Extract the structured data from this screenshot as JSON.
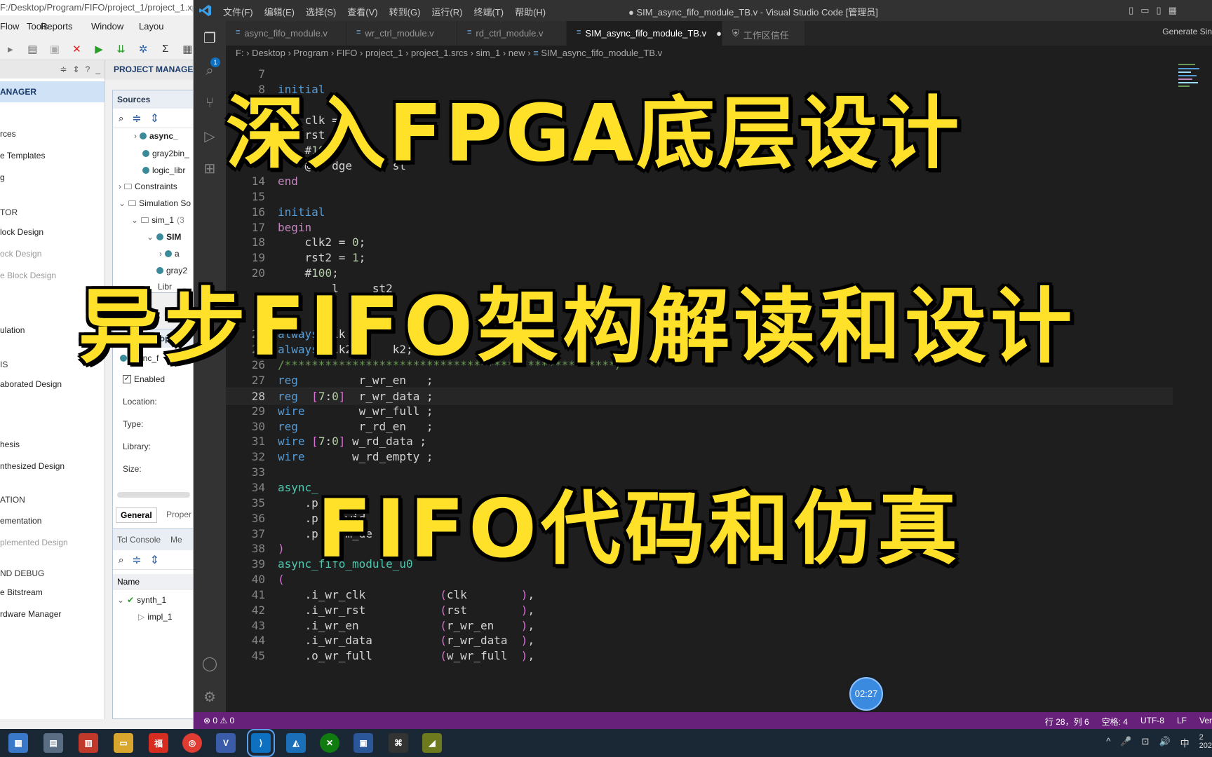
{
  "colors": {
    "accent": "#007acc",
    "status_bar": "#68217a",
    "overlay_text": "#ffe12a",
    "vivado_selection": "#cfe2f6"
  },
  "vivado": {
    "title_path": "F:/Desktop/Program/FIFO/project_1/project_1.xpr",
    "menu": [
      "Flow",
      "Tools",
      "Reports",
      "Window",
      "Layou"
    ],
    "flow_nav": {
      "section": "ANAGER",
      "items": [
        "rces",
        "e Templates",
        "g",
        "TOR",
        "lock Design",
        "ock Design",
        "e Block Design",
        "ulation",
        "IS",
        "aborated Design",
        "hesis",
        "nthesized Design",
        "ATION",
        "ementation",
        "plemented Design",
        "ND DEBUG",
        "e Bitstream",
        "rdware Manager"
      ]
    },
    "project_manager_title": "PROJECT MANAGER",
    "sources": {
      "title": "Sources",
      "rows": [
        "async_",
        "gray2bin_",
        "logic_libr",
        "Constraints",
        "Simulation So",
        "sim_1",
        "(3",
        "SIM",
        "a",
        "gray2"
      ],
      "tabs": [
        "Hi",
        "Libr"
      ]
    },
    "properties": {
      "title": "Prope",
      "file": "async_f",
      "enabled_label": "Enabled",
      "fields": [
        "Location:",
        "Type:",
        "Library:",
        "Size:"
      ],
      "tabs": [
        "General",
        "Proper"
      ]
    },
    "tcl": {
      "tabs": [
        "Tcl Console",
        "Me"
      ],
      "column": "Name",
      "rows": [
        "synth_1",
        "impl_1"
      ]
    }
  },
  "vscode": {
    "window_title": "● SIM_async_fifo_module_TB.v - Visual Studio Code [管理员]",
    "menu": [
      "文件(F)",
      "编辑(E)",
      "选择(S)",
      "查看(V)",
      "转到(G)",
      "运行(R)",
      "终端(T)",
      "帮助(H)"
    ],
    "explorer_badge": "1",
    "tabs": [
      {
        "label": "async_fifo_module.v"
      },
      {
        "label": "wr_ctrl_module.v"
      },
      {
        "label": "rd_ctrl_module.v"
      },
      {
        "label": "SIM_async_fifo_module_TB.v"
      },
      {
        "label": "工作区信任"
      }
    ],
    "tab_right": "Generate   Sin",
    "breadcrumb": [
      "F:",
      "Desktop",
      "Program",
      "FIFO",
      "project_1",
      "project_1.srcs",
      "sim_1",
      "new",
      "SIM_async_fifo_module_TB.v"
    ],
    "code": [
      {
        "n": "7",
        "t": ""
      },
      {
        "n": "8",
        "t": "initial"
      },
      {
        "n": "",
        "t": " in"
      },
      {
        "n": "",
        "t": "    clk ="
      },
      {
        "n": "",
        "t": "    rst ="
      },
      {
        "n": "",
        "t": "    #100"
      },
      {
        "n": "",
        "t": "    @(r dge      st"
      },
      {
        "n": "14",
        "t": "end"
      },
      {
        "n": "15",
        "t": ""
      },
      {
        "n": "16",
        "t": "initial"
      },
      {
        "n": "17",
        "t": "begin"
      },
      {
        "n": "18",
        "t": "    clk2 = 0;"
      },
      {
        "n": "19",
        "t": "    rst2 = 1;"
      },
      {
        "n": "20",
        "t": "    #100;"
      },
      {
        "n": "",
        "t": "        l     st2"
      },
      {
        "n": "",
        "t": ""
      },
      {
        "n": "",
        "t": ""
      },
      {
        "n": "24",
        "t": "always  lk =  "
      },
      {
        "n": "25",
        "t": "always  lk2 =    k2;"
      },
      {
        "n": "26",
        "t": "/*************************************************/"
      },
      {
        "n": "27",
        "t": "reg         r_wr_en   ;"
      },
      {
        "n": "28",
        "t": "reg  [7:0]  r_wr_data ;"
      },
      {
        "n": "29",
        "t": "wire        w_wr_full ;"
      },
      {
        "n": "30",
        "t": "reg         r_rd_en   ;"
      },
      {
        "n": "31",
        "t": "wire [7:0] w_rd_data ;"
      },
      {
        "n": "32",
        "t": "wire       w_rd_empty ;"
      },
      {
        "n": "33",
        "t": ""
      },
      {
        "n": "34",
        "t": "async_"
      },
      {
        "n": "35",
        "t": "    .p"
      },
      {
        "n": "36",
        "t": "    .p    wid"
      },
      {
        "n": "37",
        "t": "    .p    m_de"
      },
      {
        "n": "38",
        "t": ")"
      },
      {
        "n": "39",
        "t": "async_fifo_module_u0"
      },
      {
        "n": "40",
        "t": "("
      },
      {
        "n": "41",
        "t": "    .i_wr_clk           (clk        ),"
      },
      {
        "n": "42",
        "t": "    .i_wr_rst           (rst        ),"
      },
      {
        "n": "43",
        "t": "    .i_wr_en            (r_wr_en    ),"
      },
      {
        "n": "44",
        "t": "    .i_wr_data          (r_wr_data  ),"
      },
      {
        "n": "45",
        "t": "    .o_wr_full          (w_wr_full  ),"
      }
    ],
    "status": {
      "problems": "⊗ 0 ⚠ 0",
      "position": "行 28，列 6",
      "spaces": "空格: 4",
      "encoding": "UTF-8",
      "eol": "LF",
      "lang": "Ver"
    }
  },
  "overlay": {
    "line1": "深入FPGA底层设计",
    "line2": "异步FIFO架构解读和设计",
    "line3": "FIFO代码和仿真",
    "timer": "02:27"
  },
  "taskbar": {
    "tray": [
      "^",
      "🎤",
      "⊡",
      "🔊",
      "中",
      "2"
    ],
    "date": "202"
  }
}
